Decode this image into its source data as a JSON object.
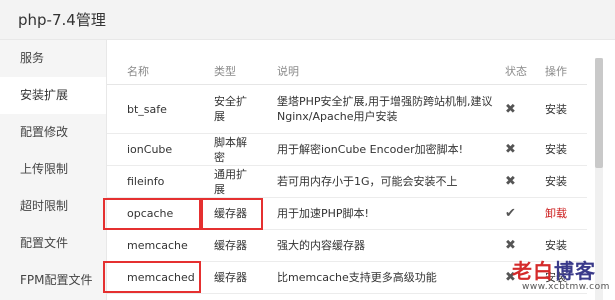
{
  "window": {
    "title": "php-7.4管理"
  },
  "sidebar": {
    "items": [
      {
        "label": "服务"
      },
      {
        "label": "安装扩展",
        "active": true
      },
      {
        "label": "配置修改"
      },
      {
        "label": "上传限制"
      },
      {
        "label": "超时限制"
      },
      {
        "label": "配置文件"
      },
      {
        "label": "FPM配置文件"
      }
    ]
  },
  "table": {
    "headers": {
      "name": "名称",
      "type": "类型",
      "desc": "说明",
      "status": "状态",
      "op": "操作"
    },
    "rows": [
      {
        "name": "bt_safe",
        "type": "安全扩展",
        "desc_line1": "堡塔PHP安全扩展,用于增强防跨站机制,建议",
        "desc_line2": "Nginx/Apache用户安装",
        "status_icon": "cross-icon",
        "status_glyph": "✖",
        "op": "安装",
        "op_danger": false
      },
      {
        "name": "ionCube",
        "type": "脚本解密",
        "desc_line1": "用于解密ionCube Encoder加密脚本!",
        "desc_line2": "",
        "status_icon": "cross-icon",
        "status_glyph": "✖",
        "op": "安装",
        "op_danger": false
      },
      {
        "name": "fileinfo",
        "type": "通用扩展",
        "desc_line1": "若可用内存小于1G，可能会安装不上",
        "desc_line2": "",
        "status_icon": "cross-icon",
        "status_glyph": "✖",
        "op": "安装",
        "op_danger": false
      },
      {
        "name": "opcache",
        "type": "缓存器",
        "desc_line1": "用于加速PHP脚本!",
        "desc_line2": "",
        "status_icon": "check-icon",
        "status_glyph": "✔",
        "op": "卸载",
        "op_danger": true
      },
      {
        "name": "memcache",
        "type": "缓存器",
        "desc_line1": "强大的内容缓存器",
        "desc_line2": "",
        "status_icon": "cross-icon",
        "status_glyph": "✖",
        "op": "安装",
        "op_danger": false
      },
      {
        "name": "memcached",
        "type": "缓存器",
        "desc_line1": "比memcache支持更多高级功能",
        "desc_line2": "",
        "status_icon": "cross-icon",
        "status_glyph": "✖",
        "op": "安装",
        "op_danger": false
      }
    ]
  },
  "watermark": {
    "logo_chars": [
      "老",
      "白",
      "博",
      "客"
    ],
    "url": "www.xcbtmw.com"
  },
  "colors": {
    "highlight": "#e53030",
    "danger": "#cc1a1a",
    "sidebar_bg": "#f5f5f5",
    "title_bg": "#f3f3f3"
  }
}
